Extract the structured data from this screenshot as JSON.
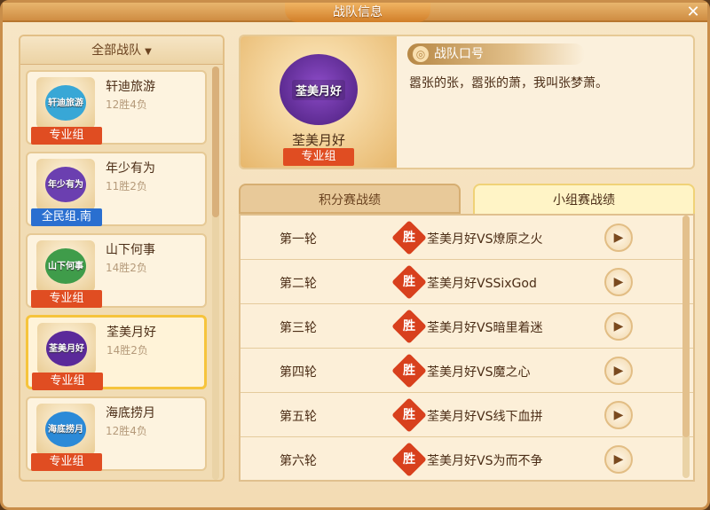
{
  "window": {
    "title": "战队信息",
    "close_icon": "close-icon"
  },
  "sidebar": {
    "filter_label": "全部战队",
    "filter_icon": "caret-down-icon",
    "teams": [
      {
        "name": "轩迪旅游",
        "record": "12胜4负",
        "tag": "专业组",
        "logo_text": "轩迪旅游",
        "logo_color": "#38a7d6"
      },
      {
        "name": "年少有为",
        "record": "11胜2负",
        "tag": "全民组.南",
        "logo_text": "年少有为",
        "logo_color": "#6b3fb0"
      },
      {
        "name": "山下何事",
        "record": "14胜2负",
        "tag": "专业组",
        "logo_text": "山下何事",
        "logo_color": "#3f9c4a"
      },
      {
        "name": "荃美月好",
        "record": "14胜2负",
        "tag": "专业组",
        "logo_text": "荃美月好",
        "logo_color": "#5b2a9a"
      },
      {
        "name": "海底捞月",
        "record": "12胜4负",
        "tag": "专业组",
        "logo_text": "海底捞月",
        "logo_color": "#2b8ad8"
      }
    ]
  },
  "team_detail": {
    "emblem_text": "荃美月好",
    "name": "荃美月好",
    "tag": "专业组",
    "slogan_header": "战队口号",
    "slogan": "嚣张的张，嚣张的萧，我叫张梦萧。"
  },
  "tabs": {
    "points": "积分赛战绩",
    "group": "小组赛战绩"
  },
  "matches": [
    {
      "round": "第一轮",
      "result": "胜",
      "title": "荃美月好VS燎原之火"
    },
    {
      "round": "第二轮",
      "result": "胜",
      "title": "荃美月好VSSixGod"
    },
    {
      "round": "第三轮",
      "result": "胜",
      "title": "荃美月好VS暗里着迷"
    },
    {
      "round": "第四轮",
      "result": "胜",
      "title": "荃美月好VS魔之心"
    },
    {
      "round": "第五轮",
      "result": "胜",
      "title": "荃美月好VS线下血拼"
    },
    {
      "round": "第六轮",
      "result": "胜",
      "title": "荃美月好VS为而不争"
    }
  ],
  "colors": {
    "accent": "#e04d22",
    "win_badge": "#d8401d",
    "tag_all": "#2a6fd0"
  }
}
